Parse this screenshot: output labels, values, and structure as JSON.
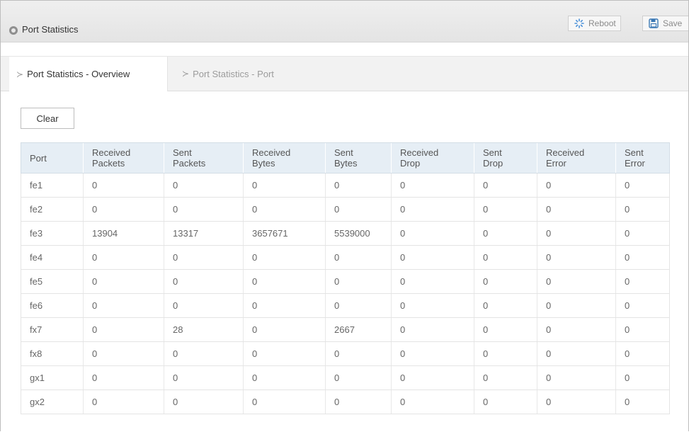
{
  "header": {
    "title": "Port Statistics",
    "icon": "circle-icon",
    "buttons": {
      "reboot_label": "Reboot",
      "save_label": "Save"
    }
  },
  "tabs": [
    {
      "label": "Port Statistics - Overview",
      "active": true
    },
    {
      "label": "Port Statistics - Port",
      "active": false
    }
  ],
  "toolbar": {
    "clear_label": "Clear"
  },
  "table": {
    "columns": [
      [
        "Port"
      ],
      [
        "Received",
        "Packets"
      ],
      [
        "Sent",
        "Packets"
      ],
      [
        "Received",
        "Bytes"
      ],
      [
        "Sent",
        "Bytes"
      ],
      [
        "Received",
        "Drop"
      ],
      [
        "Sent",
        "Drop"
      ],
      [
        "Received",
        "Error"
      ],
      [
        "Sent",
        "Error"
      ]
    ],
    "rows": [
      [
        "fe1",
        "0",
        "0",
        "0",
        "0",
        "0",
        "0",
        "0",
        "0"
      ],
      [
        "fe2",
        "0",
        "0",
        "0",
        "0",
        "0",
        "0",
        "0",
        "0"
      ],
      [
        "fe3",
        "13904",
        "13317",
        "3657671",
        "5539000",
        "0",
        "0",
        "0",
        "0"
      ],
      [
        "fe4",
        "0",
        "0",
        "0",
        "0",
        "0",
        "0",
        "0",
        "0"
      ],
      [
        "fe5",
        "0",
        "0",
        "0",
        "0",
        "0",
        "0",
        "0",
        "0"
      ],
      [
        "fe6",
        "0",
        "0",
        "0",
        "0",
        "0",
        "0",
        "0",
        "0"
      ],
      [
        "fx7",
        "0",
        "28",
        "0",
        "2667",
        "0",
        "0",
        "0",
        "0"
      ],
      [
        "fx8",
        "0",
        "0",
        "0",
        "0",
        "0",
        "0",
        "0",
        "0"
      ],
      [
        "gx1",
        "0",
        "0",
        "0",
        "0",
        "0",
        "0",
        "0",
        "0"
      ],
      [
        "gx2",
        "0",
        "0",
        "0",
        "0",
        "0",
        "0",
        "0",
        "0"
      ]
    ]
  },
  "colors": {
    "header_bg": "#e8e8e8",
    "table_header_bg": "#e6eef5",
    "save_icon": "#3a78b5",
    "reboot_icon": "#4a90d9"
  }
}
